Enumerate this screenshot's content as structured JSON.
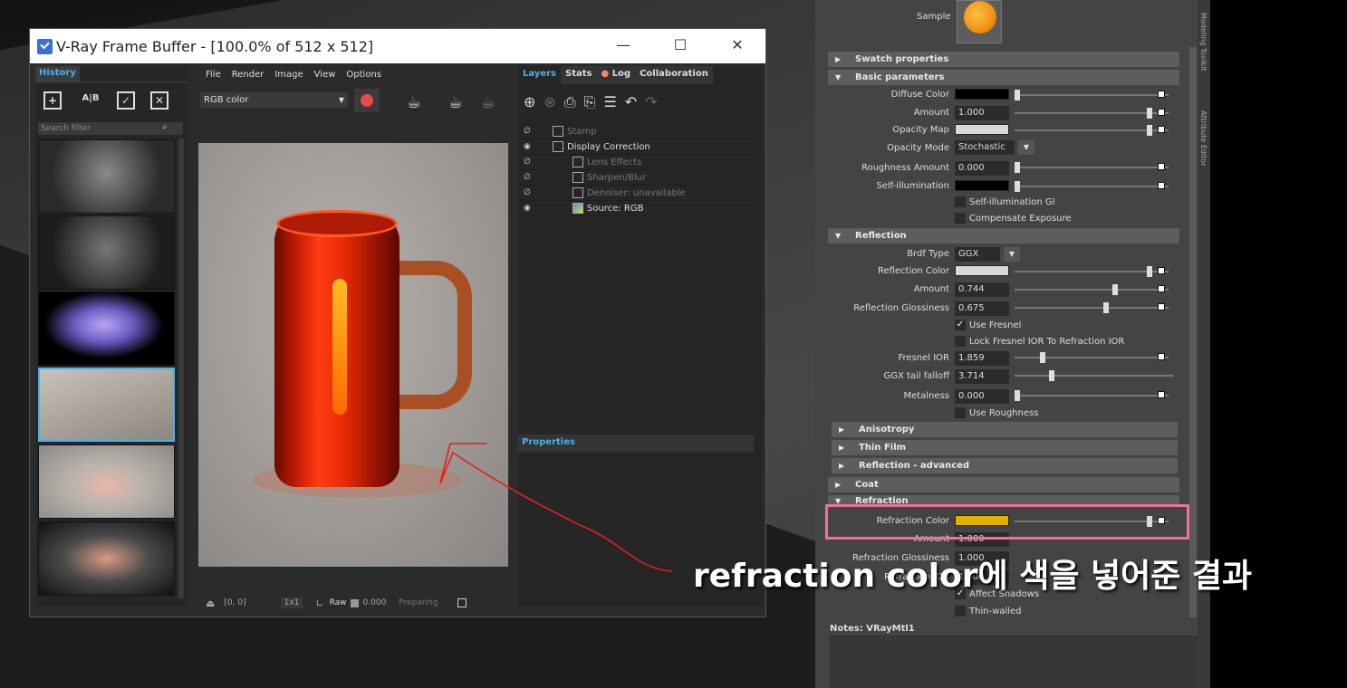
{
  "vfb": {
    "title": "V-Ray Frame Buffer - [100.0% of 512 x 512]",
    "minimize": "—",
    "maximize": "☐",
    "close": "✕",
    "history_tab": "History",
    "history_buttons": [
      "+",
      "A|B",
      "✓",
      "✕"
    ],
    "search_placeholder": "Search filter",
    "menu": [
      "File",
      "Render",
      "Image",
      "View",
      "Options"
    ],
    "channel": "RGB color",
    "status": {
      "coords": "[0, 0]",
      "zoom": "1x1",
      "raw": "Raw",
      "value": "0.000",
      "state": "Preparing"
    },
    "layer_tabs": [
      "Layers",
      "Stats",
      "Log",
      "Collaboration"
    ],
    "layers": [
      {
        "name": "Stamp",
        "dim": true
      },
      {
        "name": "Display Correction",
        "dim": false
      },
      {
        "name": "Lens Effects",
        "dim": true
      },
      {
        "name": "Sharpen/Blur",
        "dim": true
      },
      {
        "name": "Denoiser: unavailable",
        "dim": true
      },
      {
        "name": "Source: RGB",
        "dim": false
      }
    ],
    "properties_tab": "Properties"
  },
  "attr": {
    "sample_label": "Sample",
    "sections": {
      "swatch": "Swatch properties",
      "basic": "Basic parameters",
      "reflection": "Reflection",
      "anisotropy": "Anisotropy",
      "thin_film": "Thin Film",
      "refl_adv": "Reflection - advanced",
      "coat": "Coat",
      "refraction": "Refraction"
    },
    "basic": {
      "diffuse_color": "Diffuse Color",
      "amount_label": "Amount",
      "amount_value": "1.000",
      "opacity_map": "Opacity Map",
      "opacity_mode_label": "Opacity Mode",
      "opacity_mode_value": "Stochastic",
      "roughness_label": "Roughness Amount",
      "roughness_value": "0.000",
      "self_illum": "Self-illumination",
      "self_illum_gi": "Self-illumination GI",
      "comp_exposure": "Compensate Exposure"
    },
    "reflection": {
      "brdf_label": "Brdf Type",
      "brdf_value": "GGX",
      "refl_color": "Reflection Color",
      "amount_label": "Amount",
      "amount_value": "0.744",
      "gloss_label": "Reflection Glossiness",
      "gloss_value": "0.675",
      "use_fresnel": "Use Fresnel",
      "lock_fresnel": "Lock Fresnel IOR To Refraction IOR",
      "fresnel_ior_label": "Fresnel IOR",
      "fresnel_ior_value": "1.859",
      "ggx_label": "GGX tail falloff",
      "ggx_value": "3.714",
      "metalness_label": "Metalness",
      "metalness_value": "0.000",
      "use_roughness": "Use Roughness"
    },
    "refraction": {
      "color_label": "Refraction Color",
      "amount_label": "Amount",
      "amount_value": "1.000",
      "gloss_label": "Refraction Glossiness",
      "gloss_value": "1.000",
      "ior_label": "Refraction IOR",
      "ior_value": "1.600",
      "affect_shadows": "Affect Shadows",
      "thin_walled": "Thin-walled"
    },
    "notes_label": "Notes:  VRayMtl1",
    "side_tabs": [
      "Modeling Toolkit",
      "Attribute Editor"
    ],
    "colors": {
      "diffuse": "#000000",
      "opacity": "#d8d8d8",
      "self_illum": "#000000",
      "reflection": "#d8d8d8",
      "refraction": "#e6b000"
    }
  },
  "annotation": {
    "caption": "refraction color에 색을 넣어준 결과",
    "highlight_color": "#f06fa3",
    "arrow_color": "#e0201a"
  }
}
